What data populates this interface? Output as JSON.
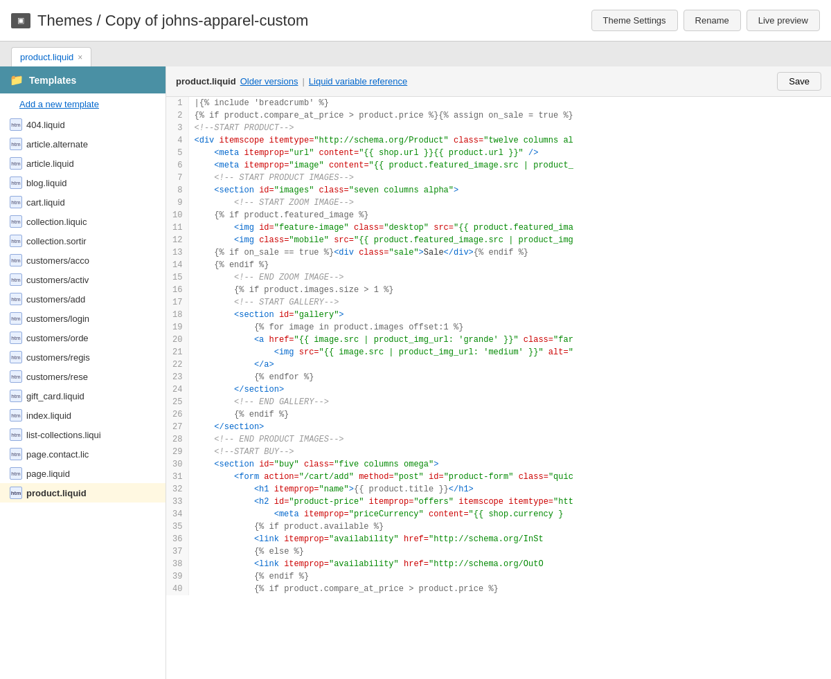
{
  "header": {
    "icon_label": "▣",
    "title": "Themes / Copy of johns-apparel-custom",
    "theme_settings_label": "Theme Settings",
    "rename_label": "Rename",
    "live_preview_label": "Live preview"
  },
  "tabs": [
    {
      "label": "product.liquid",
      "closeable": true
    }
  ],
  "sidebar": {
    "section_title": "Templates",
    "add_template_label": "Add a new template",
    "items": [
      {
        "name": "404.liquid",
        "active": false
      },
      {
        "name": "article.alternate",
        "active": false
      },
      {
        "name": "article.liquid",
        "active": false
      },
      {
        "name": "blog.liquid",
        "active": false
      },
      {
        "name": "cart.liquid",
        "active": false
      },
      {
        "name": "collection.liquic",
        "active": false
      },
      {
        "name": "collection.sortir",
        "active": false
      },
      {
        "name": "customers/acco",
        "active": false
      },
      {
        "name": "customers/activ",
        "active": false
      },
      {
        "name": "customers/add",
        "active": false
      },
      {
        "name": "customers/login",
        "active": false
      },
      {
        "name": "customers/orde",
        "active": false
      },
      {
        "name": "customers/regis",
        "active": false
      },
      {
        "name": "customers/rese",
        "active": false
      },
      {
        "name": "gift_card.liquid",
        "active": false
      },
      {
        "name": "index.liquid",
        "active": false
      },
      {
        "name": "list-collections.liqui",
        "active": false
      },
      {
        "name": "page.contact.lic",
        "active": false
      },
      {
        "name": "page.liquid",
        "active": false
      },
      {
        "name": "product.liquid",
        "active": true
      }
    ]
  },
  "editor": {
    "filename": "product.liquid",
    "older_versions_label": "Older versions",
    "liquid_ref_label": "Liquid variable reference",
    "save_label": "Save"
  }
}
